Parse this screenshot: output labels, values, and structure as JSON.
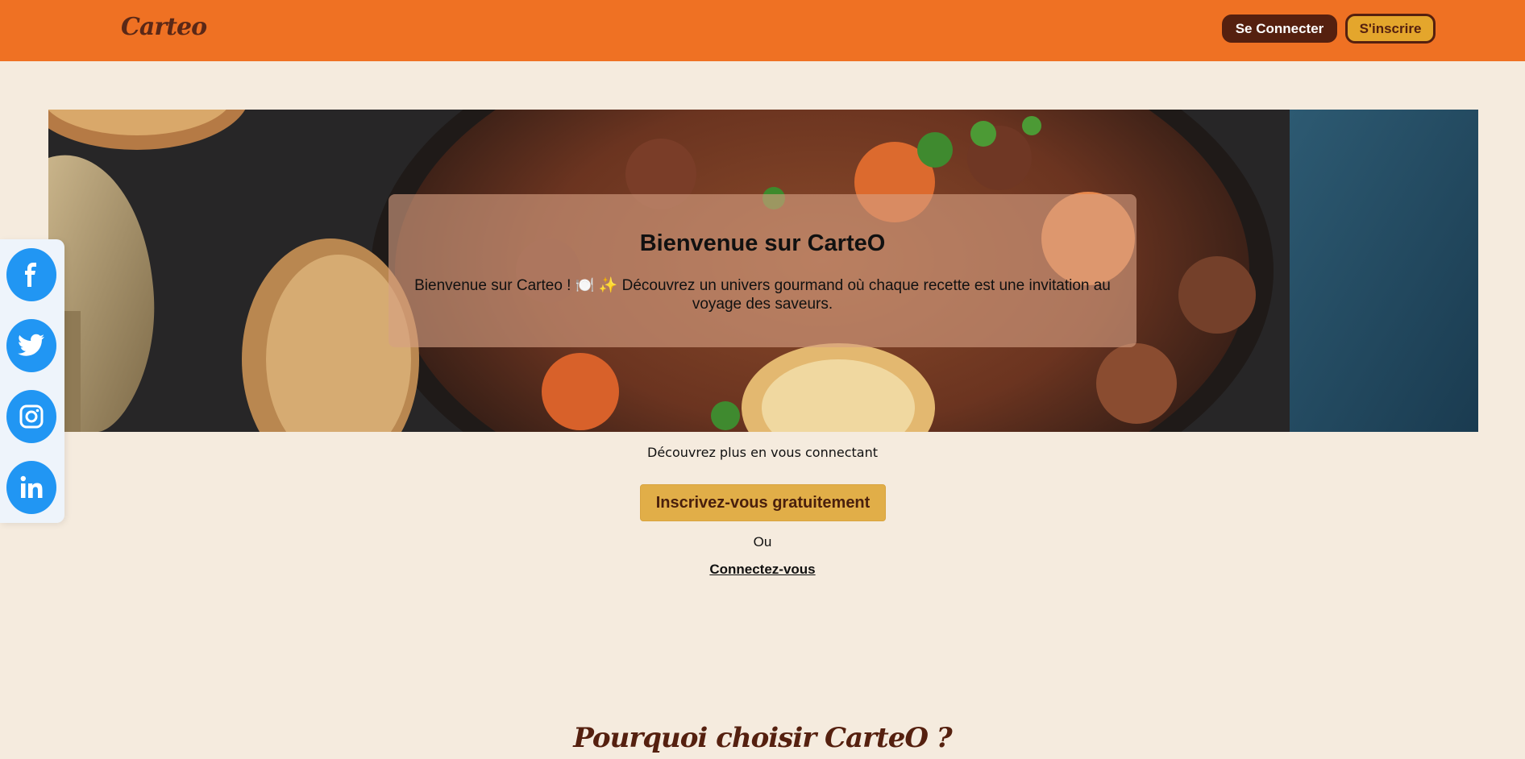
{
  "header": {
    "logo": "Carteo",
    "login_label": "Se Connecter",
    "signup_label": "S'inscrire"
  },
  "hero": {
    "image": "beef-stew-photo",
    "title": "Bienvenue sur CarteO",
    "text": "Bienvenue sur Carteo ! 🍽️ ✨ Découvrez un univers gourmand où chaque recette est une invitation au voyage des saveurs."
  },
  "social": {
    "items": [
      "facebook-icon",
      "twitter-icon",
      "instagram-icon",
      "linkedin-icon"
    ],
    "color": "#2196f3"
  },
  "main": {
    "discover_text": "Découvrez plus en vous connectant",
    "cta_label": "Inscrivez-vous gratuitement",
    "or_text": "Ou",
    "login_link": "Connectez-vous"
  },
  "why": {
    "title": "Pourquoi choisir CarteO ?"
  },
  "colors": {
    "header": "#ef7123",
    "background": "#f5ebde",
    "dark_brown": "#55200f",
    "gold": "#e1ae48"
  }
}
